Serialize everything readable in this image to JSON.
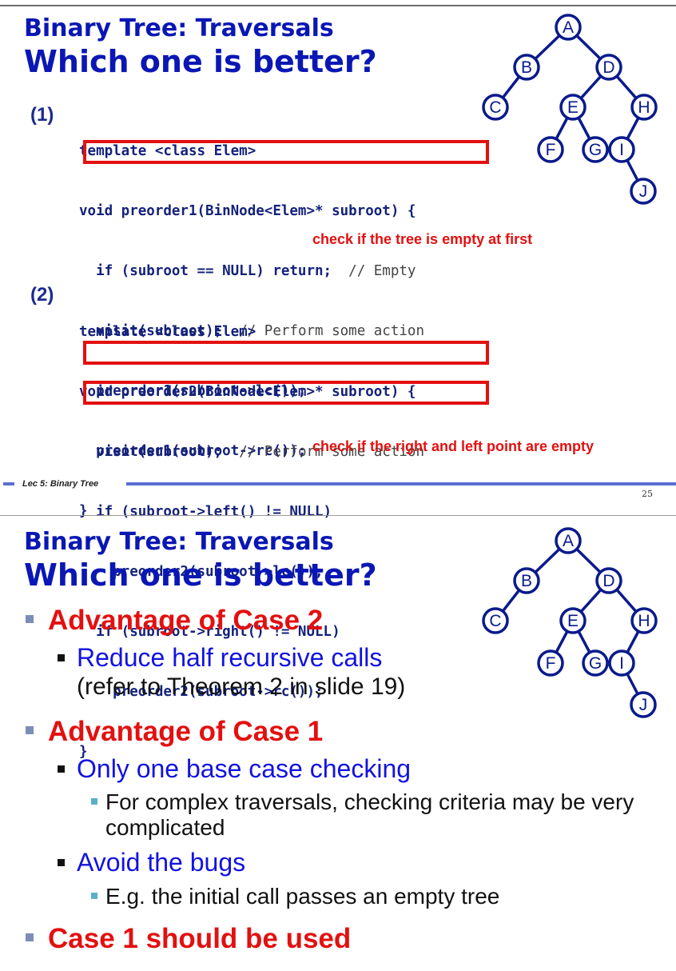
{
  "slide1": {
    "subtitle": "Binary Tree: Traversals",
    "title": "Which one is better?",
    "case1": {
      "label": "(1)",
      "lines": [
        "template <class Elem>",
        "void preorder1(BinNode<Elem>* subroot) {",
        "  if (subroot == NULL) return;  ",
        "  visit(subroot);  ",
        "  preorder1(subroot->lc());",
        "  preorder1(subroot->rc());",
        "}"
      ],
      "comment_empty": "// Empty",
      "comment_action": "// Perform some action",
      "note": "check if the tree is empty at first"
    },
    "case2": {
      "label": "(2)",
      "lines": [
        "template <class Elem>",
        "void preorder2(BinNode<Elem>* subroot) {",
        "  visit(subroot);  ",
        "  if (subroot->left() != NULL)",
        "    preorder2(subroot->lc());",
        "  if (subroot->right() != NULL)",
        "    preorder2(subroot->rc());",
        "}"
      ],
      "comment_action": "// Perform some action",
      "note": "check if the right and left point are empty"
    },
    "footer": "Lec 5: Binary Tree",
    "page_number": "25"
  },
  "slide2": {
    "subtitle": "Binary Tree: Traversals",
    "title": "Which one is better?",
    "bullets": {
      "adv2": "Advantage of Case 2",
      "adv2_sub_line1": "Reduce half recursive calls",
      "adv2_sub_line2": "(refer to Theorem 2 in slide 19)",
      "adv1": "Advantage of Case 1",
      "adv1_sub1": "Only one base case checking",
      "adv1_sub1_detail": "For complex traversals, checking criteria may be very complicated",
      "adv1_sub2": "Avoid the bugs",
      "adv1_sub2_detail": "E.g. the initial call passes an empty tree",
      "conclusion": "Case 1 should be used"
    }
  },
  "tree": {
    "nodes": [
      "A",
      "B",
      "D",
      "C",
      "E",
      "H",
      "F",
      "G",
      "I",
      "J"
    ],
    "node_color": "#0a1a8c"
  }
}
